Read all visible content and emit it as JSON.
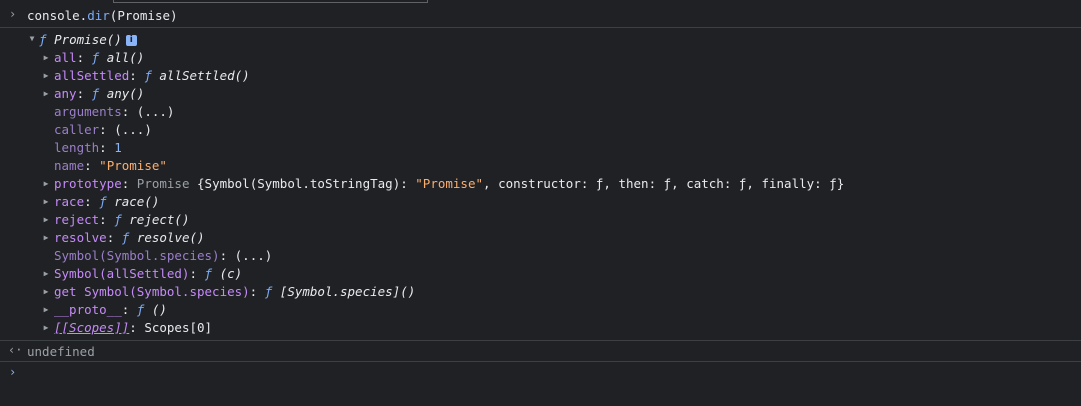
{
  "input": {
    "prompt_icon": "chevron-right-icon",
    "object": "console.",
    "method": "dir",
    "args": "(Promise)"
  },
  "tree": {
    "root": {
      "f": "ƒ",
      "name": "Promise()",
      "info": "i"
    },
    "rows": [
      {
        "key": "all",
        "f": "ƒ",
        "val": "all()"
      },
      {
        "key": "allSettled",
        "f": "ƒ",
        "val": "allSettled()"
      },
      {
        "key": "any",
        "f": "ƒ",
        "val": "any()"
      },
      {
        "key": "arguments",
        "val": "(...)"
      },
      {
        "key": "caller",
        "val": "(...)"
      },
      {
        "key": "length",
        "val": "1"
      },
      {
        "key": "name",
        "val": "\"Promise\""
      },
      {
        "key": "prototype",
        "type": "Promise",
        "open": " {",
        "sym": "Symbol(Symbol.toStringTag)",
        "sep": ": ",
        "symval": "\"Promise\"",
        "rest": ", constructor: ƒ, then: ƒ, catch: ƒ, finally: ƒ}"
      },
      {
        "key": "race",
        "f": "ƒ",
        "val": "race()"
      },
      {
        "key": "reject",
        "f": "ƒ",
        "val": "reject()"
      },
      {
        "key": "resolve",
        "f": "ƒ",
        "val": "resolve()"
      },
      {
        "key": "Symbol(Symbol.species)",
        "val": "(...)"
      },
      {
        "key": "Symbol(allSettled)",
        "f": "ƒ",
        "val": "(c)"
      },
      {
        "key": "get Symbol(Symbol.species)",
        "f": "ƒ",
        "val": "[Symbol.species]()"
      },
      {
        "key": "__proto__",
        "f": "ƒ",
        "val": "()"
      },
      {
        "key": "[[Scopes]]",
        "val": "Scopes[0]"
      }
    ]
  },
  "result": {
    "icon": "return-arrow-icon",
    "text": "undefined"
  },
  "prompt": {
    "icon": "chevron-right-icon",
    "glyph": "›"
  },
  "glyphs": {
    "gt": "›",
    "ret": "‹·",
    "tri_down": "▼",
    "tri_right": "▶"
  }
}
